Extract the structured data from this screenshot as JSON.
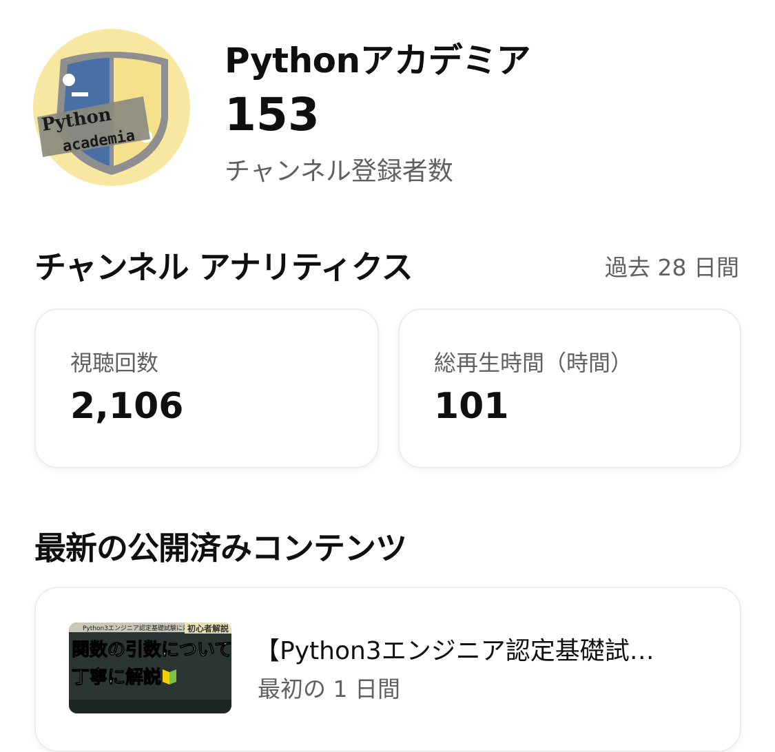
{
  "channel": {
    "name": "Pythonアカデミア",
    "subscriber_count": "153",
    "subscriber_label": "チャンネル登録者数",
    "avatar": {
      "line1": "Python",
      "line2": "academia",
      "bg_color": "#f7e7a0",
      "shield_blue": "#4a6fa5",
      "shield_yellow": "#f5e08c"
    }
  },
  "analytics": {
    "title": "チャンネル アナリティクス",
    "period": "過去 28 日間",
    "metrics": [
      {
        "label": "視聴回数",
        "value": "2,106"
      },
      {
        "label": "総再生時間（時間）",
        "value": "101"
      }
    ]
  },
  "latest": {
    "title": "最新の公開済みコンテンツ",
    "video": {
      "title": "【Python3エンジニア認定基礎試…",
      "subtitle": "最初の 1 日間",
      "thumbnail": {
        "top_text": "Python3エンジニア認定基礎試験に対応",
        "corner_text": "初心者解説",
        "line1_a": "関数の",
        "line1_b": "引数",
        "line1_c": "について",
        "line2": "丁寧に解説",
        "highlight_color": "#e53935"
      }
    }
  }
}
